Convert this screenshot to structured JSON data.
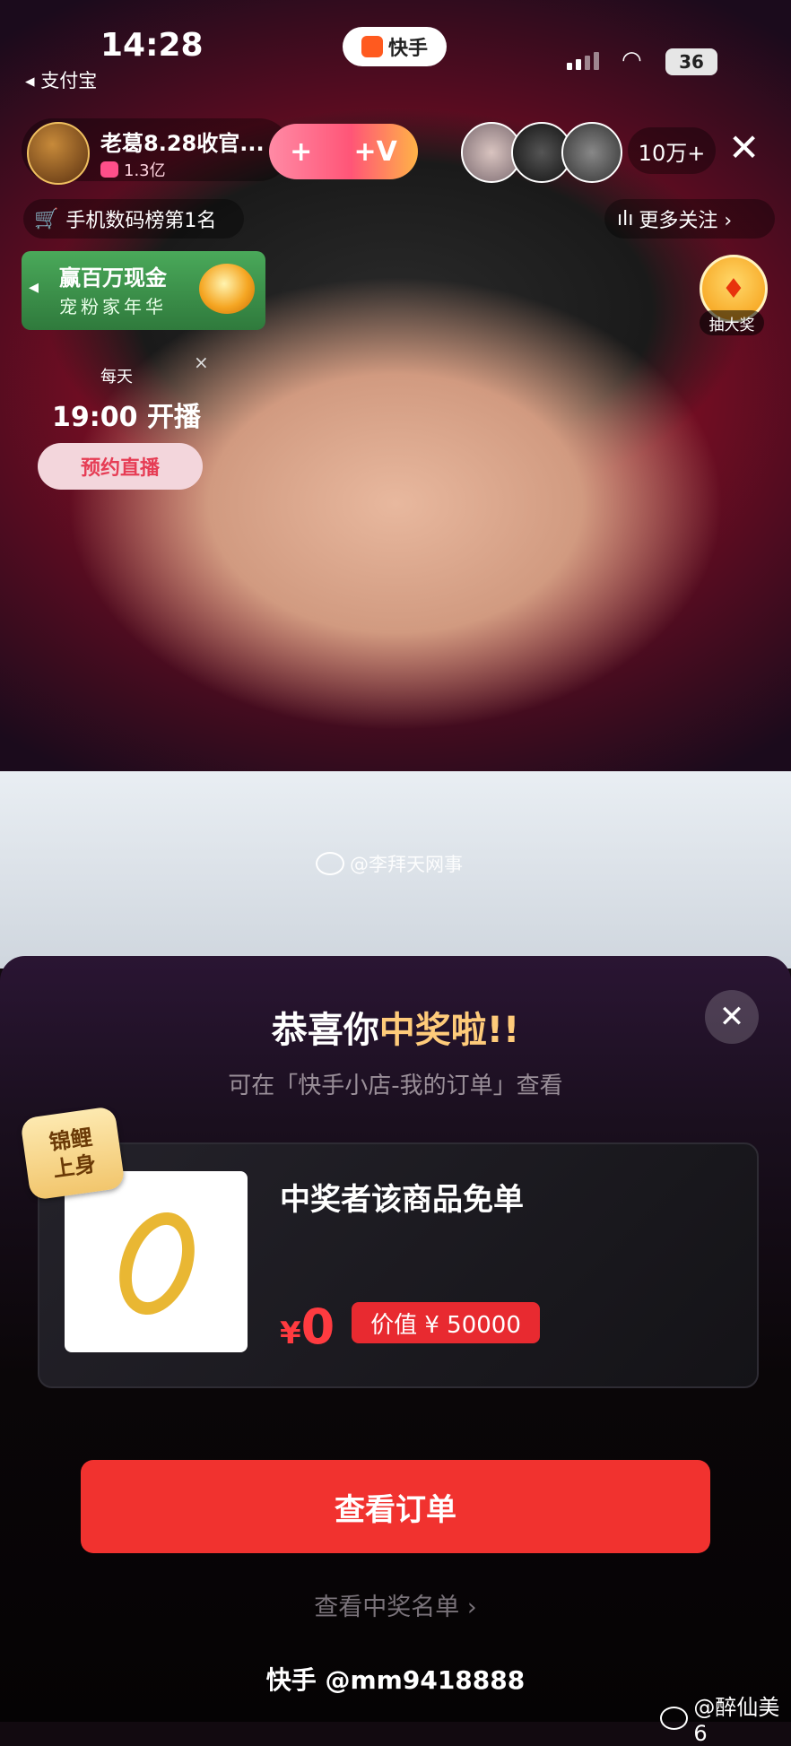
{
  "status_bar": {
    "time": "14:28",
    "back_app": "◂ 支付宝",
    "app_pill": "快手",
    "battery": "36"
  },
  "live_header": {
    "anchor_name": "老葛8.28收官...",
    "anchor_likes": "1.3亿",
    "follow_left": "+",
    "follow_right": "+V",
    "viewer_count": "10万+",
    "close": "✕",
    "rank_text": "手机数码榜第1名",
    "more_follow": "更多关注 ›"
  },
  "promo": {
    "title": "赢百万现金",
    "subtitle": "宠粉家年华",
    "lottery_label": "抽大奖"
  },
  "schedule": {
    "daily": "每天",
    "time": "19:00 开播",
    "reserve": "预约直播",
    "close": "×"
  },
  "watermark": "@李拜天网事",
  "sheet": {
    "title_prefix": "恭喜你",
    "title_highlight": "中奖啦!!",
    "subtitle": "可在「快手小店-我的订单」查看",
    "close": "✕",
    "badge_line1": "锦鲤",
    "badge_line2": "上身",
    "prize_title": "中奖者该商品免单",
    "price_currency": "¥",
    "price_value": "0",
    "value_tag": "价值 ¥ 50000",
    "order_button": "查看订单",
    "winners_link": "查看中奖名单 ›"
  },
  "footer": {
    "watermark": "快手 @mm9418888",
    "weibo": "@醉仙美6"
  },
  "colors": {
    "accent_red": "#f1322f",
    "highlight_gold": "#ffcb7a",
    "promo_green": "#3f9a4d"
  }
}
